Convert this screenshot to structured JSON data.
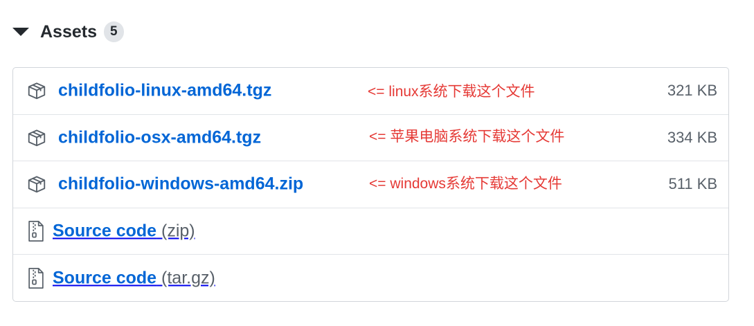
{
  "assets": {
    "title": "Assets",
    "count": "5",
    "items": [
      {
        "name": "childfolio-linux-amd64.tgz",
        "note": "<= linux系统下载这个文件",
        "size": "321 KB"
      },
      {
        "name": "childfolio-osx-amd64.tgz",
        "note": "<= 苹果电脑系统下载这个文件",
        "size": "334 KB"
      },
      {
        "name": "childfolio-windows-amd64.zip",
        "note": "<= windows系统下载这个文件",
        "size": "511 KB"
      }
    ],
    "source": [
      {
        "label": "Source code",
        "ext": "(zip)"
      },
      {
        "label": "Source code",
        "ext": "(tar.gz)"
      }
    ]
  },
  "colors": {
    "link": "#0366d6",
    "annotation": "#e53935",
    "muted": "#586069"
  },
  "icons": {
    "toggle": "triangle-down-icon",
    "asset": "package-icon",
    "source": "file-zip-icon"
  }
}
